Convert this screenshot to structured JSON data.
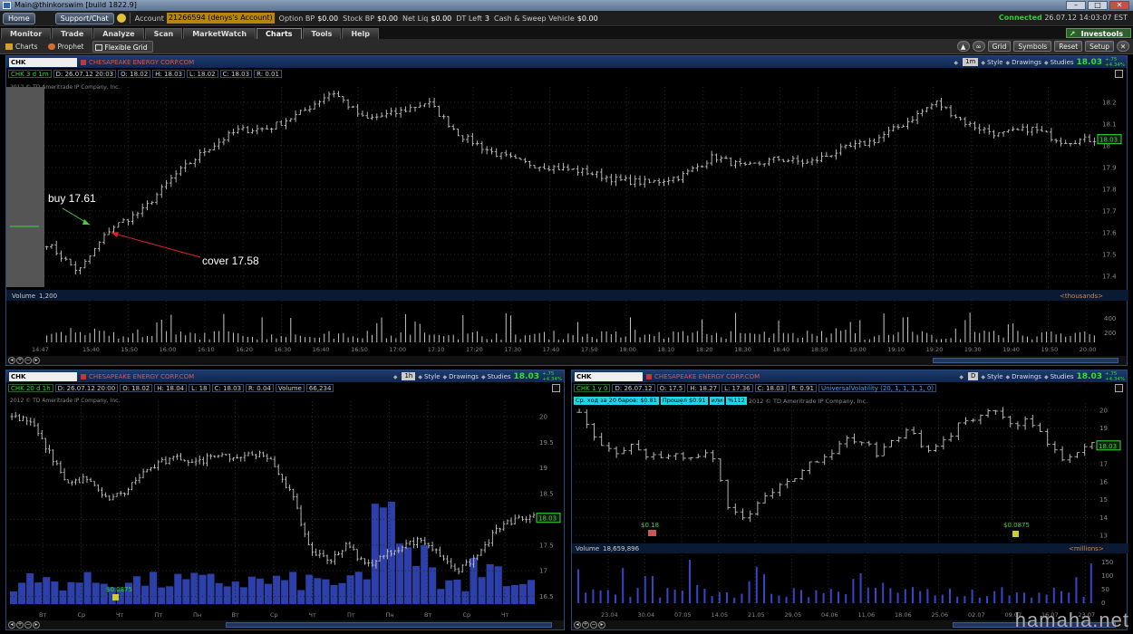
{
  "window": {
    "title": "Main@thinkorswim [build 1822.9]"
  },
  "account_bar": {
    "home_label": "Home",
    "support_label": "Support/Chat",
    "account_label": "Account",
    "account_value": "21266594 (denys's Account)",
    "option_bp_label": "Option BP",
    "option_bp_value": "$0.00",
    "stock_bp_label": "Stock BP",
    "stock_bp_value": "$0.00",
    "net_liq_label": "Net Liq",
    "net_liq_value": "$0.00",
    "dt_left_label": "DT Left",
    "dt_left_value": "3",
    "cash_label": "Cash & Sweep Vehicle",
    "cash_value": "$0.00",
    "connected_label": "Connected",
    "connected_time": "26.07.12 14:03:07 EST"
  },
  "main_tabs": [
    "Monitor",
    "Trade",
    "Analyze",
    "Scan",
    "MarketWatch",
    "Charts",
    "Tools",
    "Help"
  ],
  "active_tab": "Charts",
  "investools_label": "Investools",
  "sub_tabs": {
    "charts": "Charts",
    "prophet": "Prophet",
    "flexible_grid": "Flexible Grid"
  },
  "toolbar_right": {
    "grid": "Grid",
    "symbols": "Symbols",
    "reset": "Reset",
    "setup": "Setup"
  },
  "panel_common": {
    "company": "CHESAPEAKE ENERGY CORP.COM",
    "style": "Style",
    "drawings": "Drawings",
    "studies": "Studies",
    "copyright": "2012 © TD Ameritrade IP Company, Inc."
  },
  "panel_top": {
    "symbol": "CHK",
    "timeframe": "1m",
    "last": "18.03",
    "change": "+.75 +4.34%",
    "info": {
      "sym": "CHK 3 d 1m",
      "date": "D: 26.07.12 20:03",
      "o": "O: 18.02",
      "h": "H: 18.03",
      "l": "L: 18.02",
      "c": "C: 18.03",
      "r": "R: 0.01"
    },
    "price_axis": [
      "18.2",
      "18.1",
      "18",
      "17.9",
      "17.8",
      "17.7",
      "17.6",
      "17.5",
      "17.4"
    ],
    "price_tag": "18.03",
    "volume_label": "Volume",
    "volume_value": "1,200",
    "volume_units": "<thousands>",
    "volume_axis": [
      "400",
      "200"
    ],
    "time_axis": [
      "14:47",
      "15:40",
      "15:50",
      "16:00",
      "16:10",
      "16:20",
      "16:30",
      "16:40",
      "16:50",
      "17:00",
      "17:10",
      "17:20",
      "17:30",
      "17:40",
      "17:50",
      "18:00",
      "18:10",
      "18:20",
      "18:30",
      "18:40",
      "18:50",
      "19:00",
      "19:10",
      "19:20",
      "19:30",
      "19:40",
      "19:50",
      "20:00"
    ],
    "annotations": {
      "buy": "buy 17.61",
      "cover": "cover 17.58"
    }
  },
  "panel_bl": {
    "symbol": "CHK",
    "timeframe": "1h",
    "last": "18.03",
    "change": "+.75 +4.34%",
    "info": {
      "sym": "CHK 20 d 1h",
      "date": "D: 26.07.12 20:00",
      "o": "O: 18.02",
      "h": "H: 18.04",
      "l": "L: 18",
      "c": "C: 18.03",
      "r": "R: 0.04",
      "volume": "Volume",
      "volume_value": "66,234"
    },
    "price_axis": [
      "20",
      "19.5",
      "19",
      "18.5",
      "18",
      "17.5",
      "17",
      "16.5"
    ],
    "price_tag": "18.03",
    "dividend": "$0.0875",
    "day_axis": [
      "Вт",
      "Ср",
      "Чт",
      "Пт",
      "Пн",
      "Вт",
      "Ср",
      "Чт",
      "Пт",
      "Пн",
      "Вт",
      "Ср",
      "Чт"
    ]
  },
  "panel_br": {
    "symbol": "CHK",
    "timeframe": "D",
    "last": "18.03",
    "change": "+.75 +4.34%",
    "info": {
      "sym": "CHK 1 y 0",
      "date": "D: 26.07.12",
      "o": "O: 17.5",
      "h": "H: 18.27",
      "l": "L: 17.36",
      "c": "C: 18.03",
      "r": "R: 0.91",
      "study": "UniversalVolatility (20, 1, 1, 1, 1, 0)"
    },
    "volatility": {
      "avg": "Ср. ход за 20 баров: $0.81",
      "passed": "Прошел $0.91",
      "or": "или",
      "pct": "%112"
    },
    "price_axis": [
      "20",
      "19",
      "18",
      "17",
      "16",
      "15",
      "14",
      "13"
    ],
    "price_tag": "18.03",
    "dividends": [
      "$0.18",
      "$0.0875"
    ],
    "volume_label": "Volume",
    "volume_value": "18,659,896",
    "volume_units": "<millions>",
    "volume_axis": [
      "150",
      "100",
      "50",
      "0"
    ],
    "date_axis": [
      "23.04",
      "30.04",
      "07.05",
      "14.05",
      "21.05",
      "29.05",
      "04.06",
      "11.06",
      "18.06",
      "25.06",
      "02.07",
      "09.07",
      "16.07",
      "23.07"
    ]
  },
  "watermark": "hamaha.net",
  "colors": {
    "price_line": "#c8c8c8",
    "volume_bars": "#c8c8c8",
    "blue_volume": "#2d3fa8",
    "vol_bars_br": "#3645c8",
    "grid": "#1a2a1a",
    "accent_green": "#33dd33"
  }
}
